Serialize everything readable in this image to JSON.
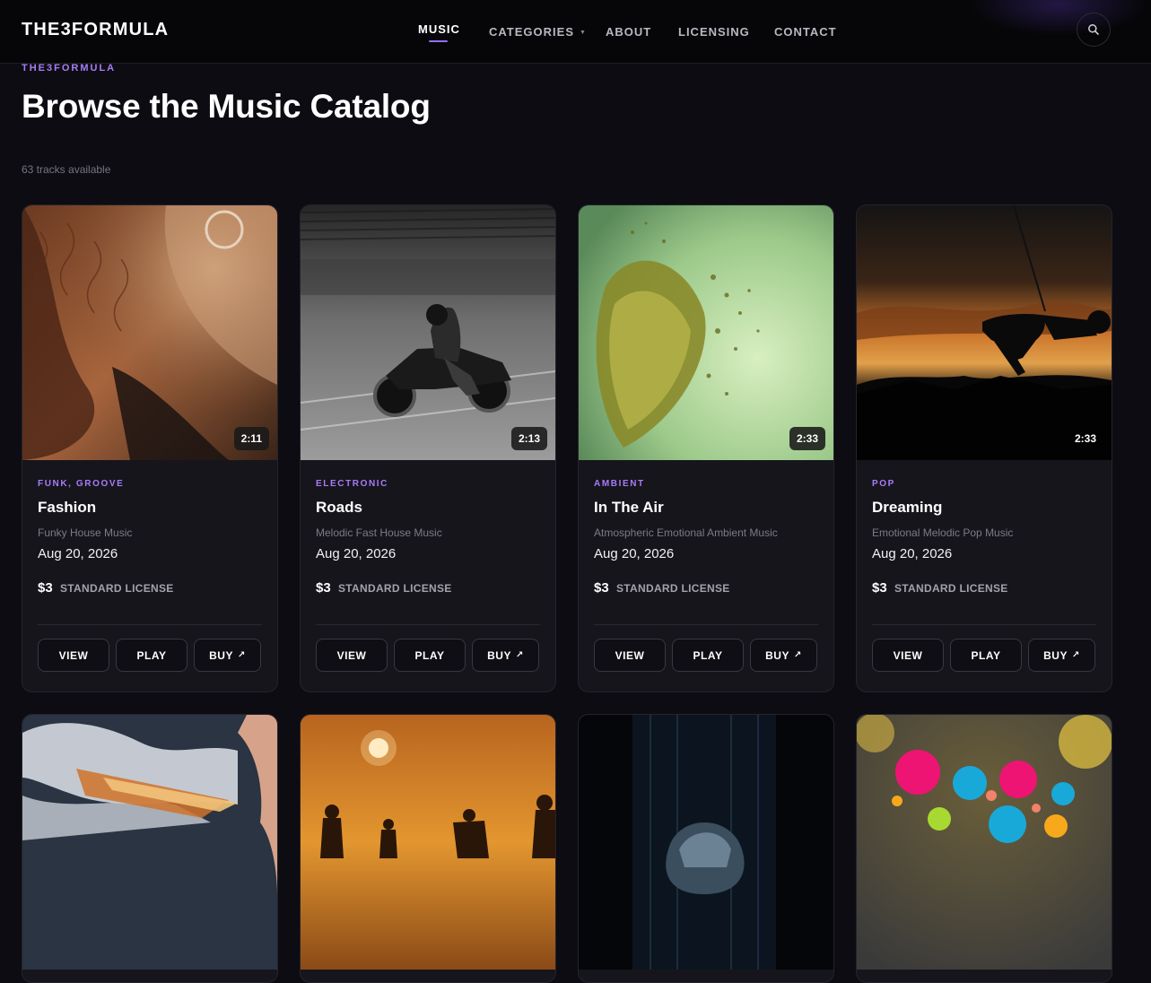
{
  "header": {
    "logo": "THE3FORMULA",
    "nav": [
      "MUSIC",
      "CATEGORIES",
      "ABOUT",
      "LICENSING",
      "CONTACT"
    ],
    "active": "MUSIC",
    "search_icon": "search-icon"
  },
  "page": {
    "eyebrow": "THE3FORMULA",
    "title": "Browse the Music Catalog",
    "count": "63 tracks available"
  },
  "cards": [
    {
      "genre": "FUNK, GROOVE",
      "title": "Fashion",
      "subtitle": "Funky House Music",
      "date": "Aug 20, 2026",
      "duration": "2:11",
      "price": "$3",
      "license": "STANDARD LICENSE",
      "view": "VIEW",
      "play": "PLAY",
      "buy": "BUY",
      "buy_icon": "↗"
    },
    {
      "genre": "ELECTRONIC",
      "title": "Roads",
      "subtitle": "Melodic Fast House Music",
      "date": "Aug 20, 2026",
      "duration": "2:13",
      "price": "$3",
      "license": "STANDARD LICENSE",
      "view": "VIEW",
      "play": "PLAY",
      "buy": "BUY",
      "buy_icon": "↗"
    },
    {
      "genre": "AMBIENT",
      "title": "In The Air",
      "subtitle": "Atmospheric Emotional Ambient Music",
      "date": "Aug 20, 2026",
      "duration": "2:33",
      "price": "$3",
      "license": "STANDARD LICENSE",
      "view": "VIEW",
      "play": "PLAY",
      "buy": "BUY",
      "buy_icon": "↗"
    },
    {
      "genre": "POP",
      "title": "Dreaming",
      "subtitle": "Emotional Melodic Pop Music",
      "date": "Aug 20, 2026",
      "duration": "2:33",
      "price": "$3",
      "license": "STANDARD LICENSE",
      "view": "VIEW",
      "play": "PLAY",
      "buy": "BUY",
      "buy_icon": "↗"
    }
  ],
  "colors": {
    "accent": "#a77cf7",
    "background": "#0d0c12",
    "card": "#16151c"
  }
}
